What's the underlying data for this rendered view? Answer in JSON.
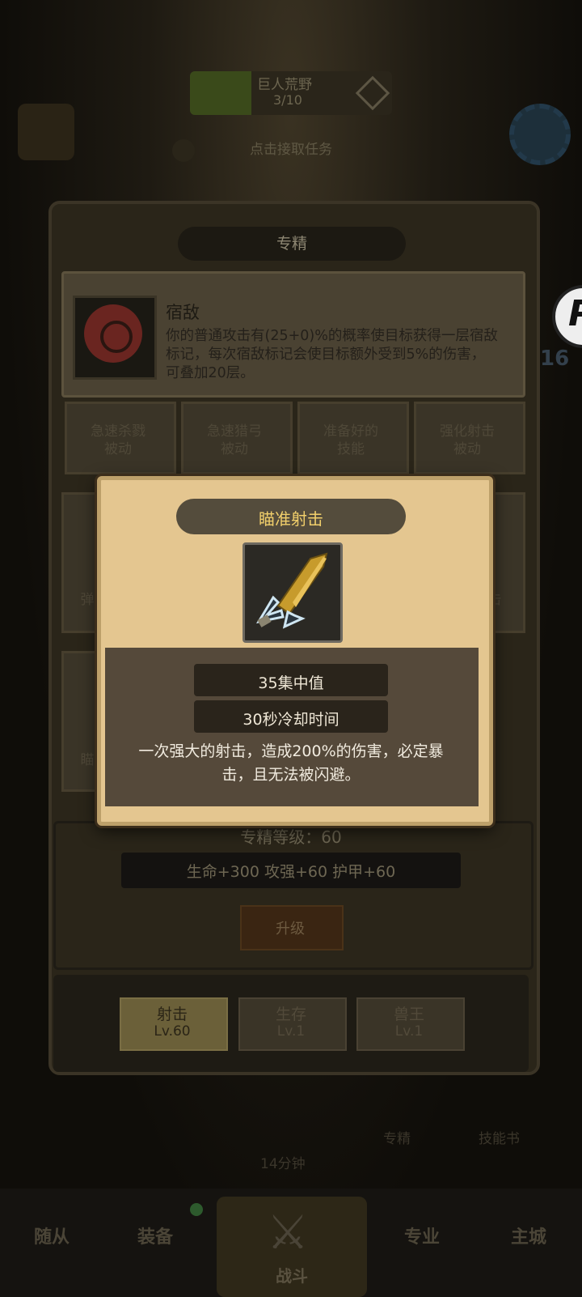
{
  "background": {
    "quest_title": "巨人荒野",
    "quest_progress": "3/10",
    "quest_hint": "点击接取任务",
    "right_badge": "P",
    "right_number": "16",
    "timer": "14分钟",
    "row_labels": [
      "专精",
      "技能书"
    ],
    "bottom_nav": [
      "随从",
      "装备",
      "战斗",
      "专业",
      "主城"
    ]
  },
  "panel": {
    "title": "专精",
    "talent": {
      "name": "宿敌",
      "description": "你的普通攻击有(25+0)%的概率使目标获得一层宿敌标记，每次宿敌标记会使目标额外受到5%的伤害，可叠加20层。"
    },
    "dim_grid_row1": [
      "急速杀戮\n被动",
      "急速猎弓\n被动",
      "准备好的\n技能",
      "强化射击\n被动"
    ],
    "dim_side_left": [
      "弹",
      "瞄"
    ],
    "dim_side_right": [
      "击"
    ],
    "spec_level": "专精等级：60",
    "bonus": "生命+300  攻强+60  护甲+60",
    "upgrade_label": "升级",
    "tabs": [
      {
        "name": "射击",
        "level": "Lv.60",
        "active": true
      },
      {
        "name": "生存",
        "level": "Lv.1",
        "active": false
      },
      {
        "name": "兽王",
        "level": "Lv.1",
        "active": false
      }
    ]
  },
  "popup": {
    "title": "瞄准射击",
    "icon": "arrow-icon",
    "cost": "35集中值",
    "cooldown": "30秒冷却时间",
    "description": "一次强大的射击，造成200%的伤害，必定暴击，且无法被闪避。"
  },
  "colors": {
    "popup_title": "#f1cf6b",
    "popup_parchment": "#e4c690",
    "active_tab": "#6b6039"
  }
}
